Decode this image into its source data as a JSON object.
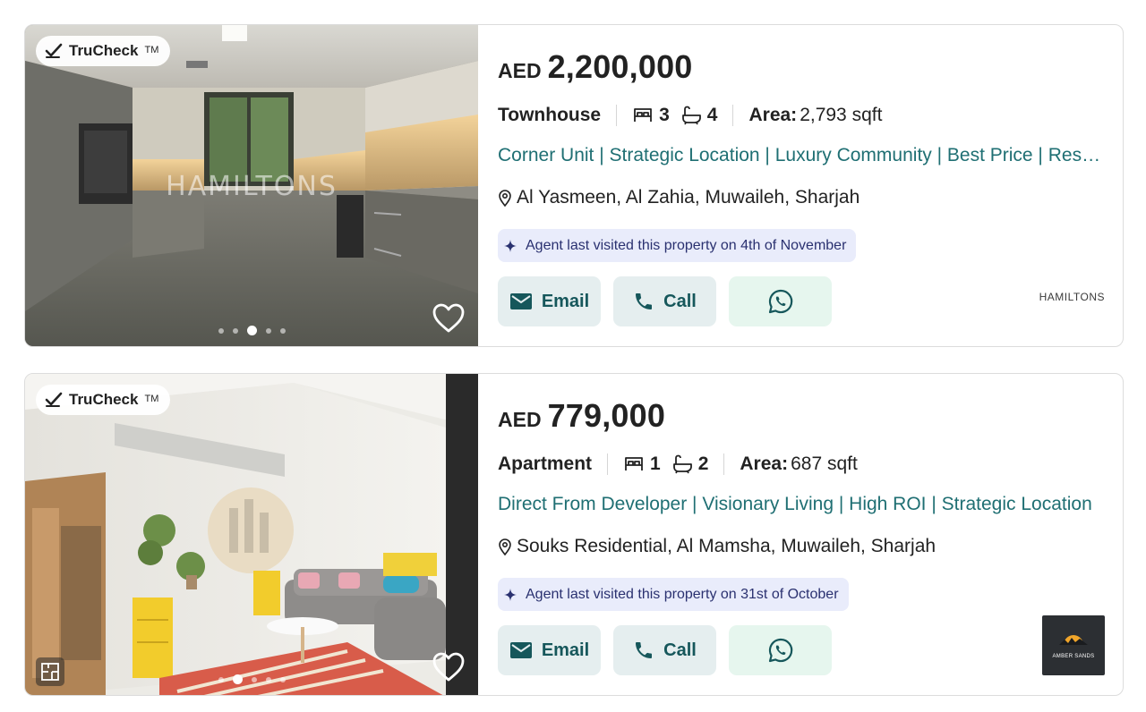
{
  "listings": [
    {
      "badge": {
        "label": "TruCheck",
        "tm": "TM"
      },
      "watermark": "HAMILTONS",
      "carousel": {
        "total": 5,
        "active": 3
      },
      "price": {
        "currency": "AED",
        "amount": "2,200,000"
      },
      "type": "Townhouse",
      "bedrooms": "3",
      "bathrooms": "4",
      "area": {
        "label": "Area:",
        "value": "2,793 sqft"
      },
      "title": "Corner Unit | Strategic Location | Luxury Community | Best Price | Resale",
      "location": "Al Yasmeen, Al Zahia, Muwaileh, Sharjah",
      "visit_note": "Agent last visited this property on 4th of November",
      "actions": {
        "email": "Email",
        "call": "Call"
      },
      "agency": "HAMILTONS"
    },
    {
      "badge": {
        "label": "TruCheck",
        "tm": "TM"
      },
      "carousel": {
        "total": 5,
        "active": 2
      },
      "price": {
        "currency": "AED",
        "amount": "779,000"
      },
      "type": "Apartment",
      "bedrooms": "1",
      "bathrooms": "2",
      "area": {
        "label": "Area:",
        "value": "687 sqft"
      },
      "title": "Direct From Developer | Visionary Living | High ROI | Strategic Location",
      "location": "Souks Residential, Al Mamsha, Muwaileh, Sharjah",
      "visit_note": "Agent last visited this property on 31st of October",
      "actions": {
        "email": "Email",
        "call": "Call"
      },
      "agency": "AMBER SANDS"
    }
  ],
  "colors": {
    "accent": "#1f6f73",
    "button_bg": "#e5eeef",
    "whatsapp_bg": "#e6f6ee",
    "whatsapp_icon": "#16575b",
    "visit_bg": "#e9ecfb"
  },
  "icons": [
    "check-icon",
    "heart-icon",
    "bed-icon",
    "bath-icon",
    "pin-icon",
    "sparkle-icon",
    "email-icon",
    "phone-icon",
    "whatsapp-icon",
    "floorplan-icon"
  ]
}
